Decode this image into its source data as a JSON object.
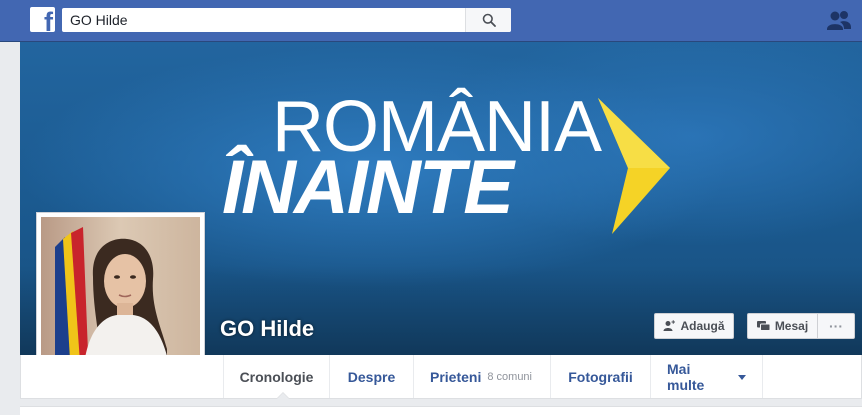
{
  "header": {
    "logo_letter": "f",
    "search": {
      "value": "GO Hilde"
    }
  },
  "cover": {
    "brand_line1": "ROMÂNIA",
    "brand_line2": "ÎNAINTE",
    "colors": {
      "background": "#1f5d94",
      "triangle": "#f5d326"
    }
  },
  "profile": {
    "name": "GO Hilde"
  },
  "actions": {
    "add_label": "Adaugă",
    "message_label": "Mesaj",
    "more_label": "···"
  },
  "tabs": [
    {
      "label": "Cronologie",
      "sub": ""
    },
    {
      "label": "Despre",
      "sub": ""
    },
    {
      "label": "Prieteni",
      "sub": "8 comuni"
    },
    {
      "label": "Fotografii",
      "sub": ""
    },
    {
      "label": "Mai multe",
      "sub": ""
    }
  ],
  "colors": {
    "facebook_blue": "#4267b2",
    "link": "#365899",
    "page_bg": "#e9ebee"
  }
}
